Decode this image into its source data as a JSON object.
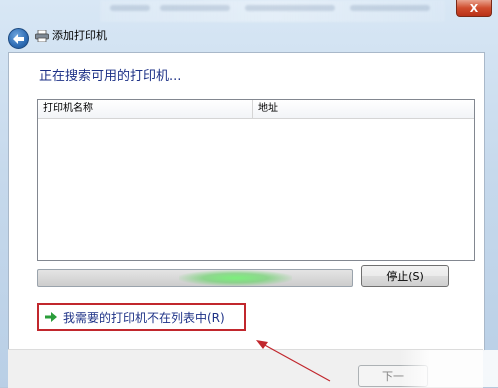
{
  "window": {
    "title": "添加打印机",
    "close_glyph": "X"
  },
  "search": {
    "heading": "正在搜索可用的打印机..."
  },
  "printer_list": {
    "columns": [
      "打印机名称",
      "地址"
    ],
    "rows": []
  },
  "progress": {
    "indeterminate": true,
    "glow_center_fraction": 0.63
  },
  "buttons": {
    "stop": "停止(S)",
    "next": "下一"
  },
  "link": {
    "not_listed": "我需要的打印机不在列表中(R)"
  },
  "colors": {
    "accent_text": "#1e3287",
    "highlight_box": "#c1272d",
    "progress_glow": "#7cf07c",
    "link_arrow": "#2a9d3a"
  }
}
